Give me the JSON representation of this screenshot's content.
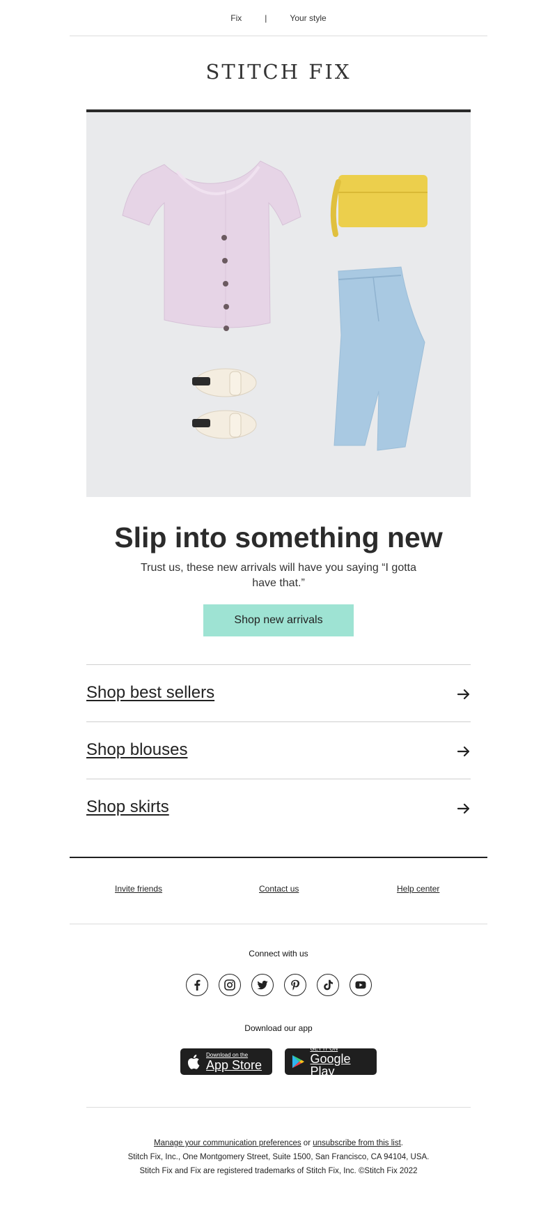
{
  "nav": {
    "fix": "Fix",
    "separator": "|",
    "your_style": "Your style"
  },
  "brand": {
    "logo": "STITCH FIX"
  },
  "hero": {
    "image_icon": "outfit-flatlay-image"
  },
  "headline": "Slip into something new",
  "subcopy": "Trust us, these new arrivals will have you saying “I gotta have that.”",
  "cta": {
    "label": "Shop new arrivals",
    "color": "#9ee3d3"
  },
  "shop_links": [
    {
      "label": "Shop best sellers",
      "icon": "arrow-right-icon"
    },
    {
      "label": "Shop blouses",
      "icon": "arrow-right-icon"
    },
    {
      "label": "Shop skirts",
      "icon": "arrow-right-icon"
    }
  ],
  "footer_links": {
    "invite": "Invite friends",
    "contact": "Contact us",
    "help": "Help center"
  },
  "connect": {
    "title": "Connect with us",
    "icons": [
      "facebook-icon",
      "instagram-icon",
      "twitter-icon",
      "pinterest-icon",
      "tiktok-icon",
      "youtube-icon"
    ]
  },
  "download": {
    "title": "Download our app",
    "app_store": {
      "small": "Download on the",
      "big": "App Store"
    },
    "google_play": {
      "small": "GET IT ON",
      "big": "Google Play"
    }
  },
  "legal": {
    "manage": "Manage your communication preferences",
    "or": " or ",
    "unsubscribe": "unsubscribe from this list",
    "period": ".",
    "address": "Stitch Fix, Inc., One Montgomery Street, Suite 1500, San Francisco, CA 94104, USA.",
    "trademark": "Stitch Fix and Fix are registered trademarks of Stitch Fix, Inc. ©Stitch Fix 2022"
  }
}
